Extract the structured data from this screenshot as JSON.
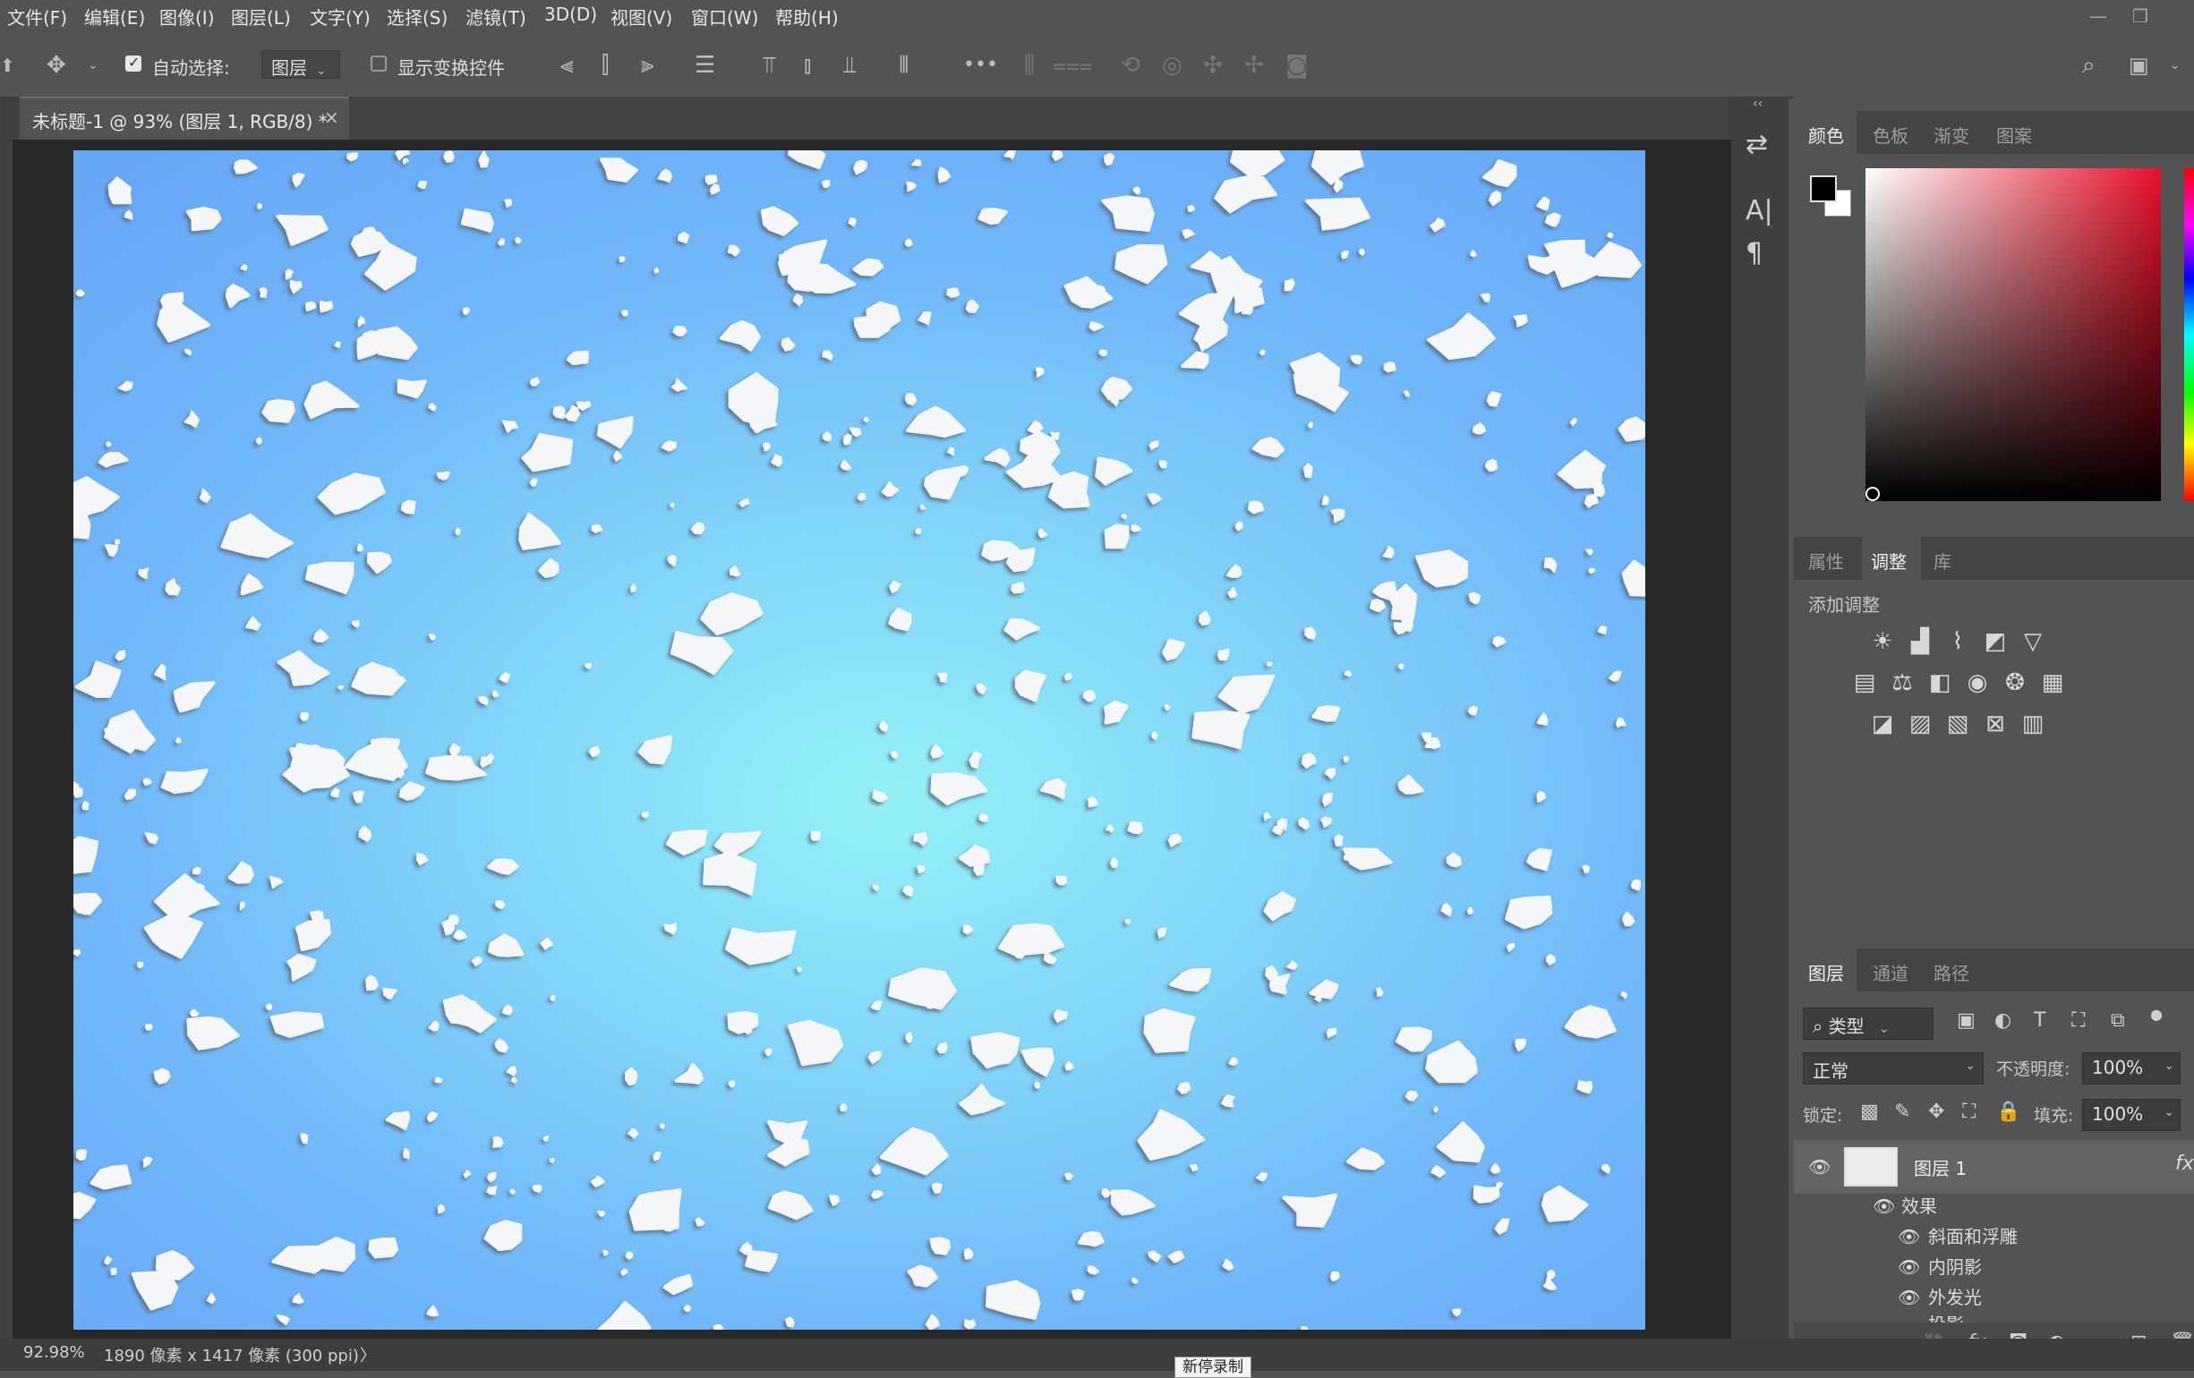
{
  "menu": {
    "items": [
      "文件(F)",
      "编辑(E)",
      "图像(I)",
      "图层(L)",
      "文字(Y)",
      "选择(S)",
      "滤镜(T)",
      "3D(D)",
      "视图(V)",
      "窗口(W)",
      "帮助(H)"
    ],
    "window_controls": {
      "minimize": "—",
      "restore": "❐"
    }
  },
  "options_bar": {
    "move_tool_icon": "move-icon",
    "auto_select_label": "自动选择:",
    "auto_select_checked": true,
    "auto_select_target": "图层",
    "show_transform_label": "显示变换控件",
    "show_transform_checked": false,
    "more_label": "•••"
  },
  "document": {
    "tab_title": "未标题-1 @ 93% (图层 1, RGB/8) *",
    "close": "×"
  },
  "status_bar": {
    "zoom": "92.98%",
    "doc_info": "1890 像素 x 1417 像素 (300 ppi)",
    "arrow": "〉",
    "tooltip": "新停录制"
  },
  "color_panel": {
    "tabs": [
      "颜色",
      "色板",
      "渐变",
      "图案"
    ],
    "active_tab": 0,
    "foreground": "#000000",
    "background": "#ffffff",
    "hue_color": "#e8102a"
  },
  "adjust_panel": {
    "tabs": [
      "属性",
      "调整",
      "库"
    ],
    "active_tab": 1,
    "heading": "添加调整"
  },
  "layers_panel": {
    "tabs": [
      "图层",
      "通道",
      "路径"
    ],
    "active_tab": 0,
    "filter_label": "类型",
    "blend_mode": "正常",
    "opacity_label": "不透明度:",
    "opacity_value": "100%",
    "lock_label": "锁定:",
    "fill_label": "填充:",
    "fill_value": "100%",
    "layer_name": "图层 1",
    "fx_badge": "fx",
    "effects_label": "效果",
    "effects": [
      "斜面和浮雕",
      "内阴影",
      "外发光",
      "投影"
    ],
    "bottom_fx": "fx."
  }
}
